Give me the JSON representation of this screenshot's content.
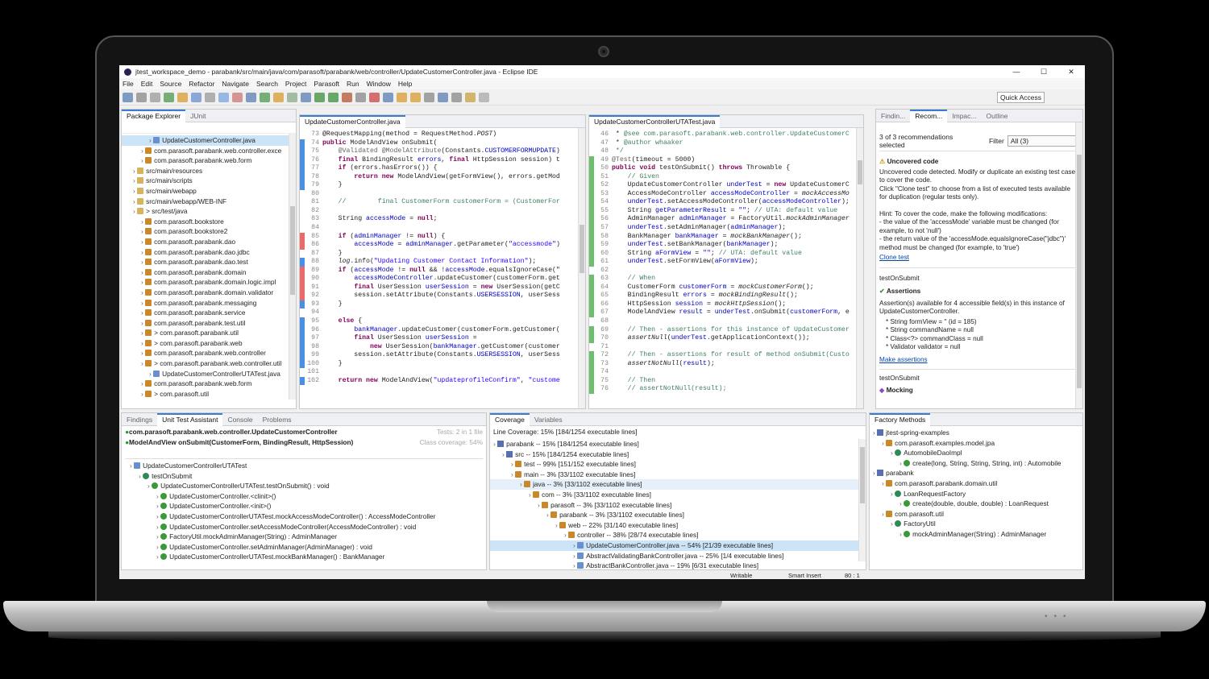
{
  "window_title": "jtest_workspace_demo - parabank/src/main/java/com/parasoft/parabank/web/controller/UpdateCustomerController.java - Eclipse IDE",
  "menu": [
    "File",
    "Edit",
    "Source",
    "Refactor",
    "Navigate",
    "Search",
    "Project",
    "Parasoft",
    "Run",
    "Window",
    "Help"
  ],
  "quick_access": "Quick Access",
  "package_explorer": {
    "tabs": [
      "Package Explorer",
      "JUnit"
    ],
    "rows": [
      {
        "indent": 3,
        "icon": "jfile",
        "label": "UpdateCustomerController.java",
        "sel": true
      },
      {
        "indent": 2,
        "icon": "pkg",
        "label": "com.parasoft.parabank.web.controller.exce"
      },
      {
        "indent": 2,
        "icon": "pkg",
        "label": "com.parasoft.parabank.web.form"
      },
      {
        "indent": 1,
        "icon": "fld",
        "label": "src/main/resources"
      },
      {
        "indent": 1,
        "icon": "fld",
        "label": "src/main/scripts"
      },
      {
        "indent": 1,
        "icon": "fld",
        "label": "src/main/webapp"
      },
      {
        "indent": 1,
        "icon": "fld",
        "label": "src/main/webapp/WEB-INF"
      },
      {
        "indent": 1,
        "icon": "fld",
        "label": "> src/test/java"
      },
      {
        "indent": 2,
        "icon": "pkg",
        "label": "com.parasoft.bookstore"
      },
      {
        "indent": 2,
        "icon": "pkg",
        "label": "com.parasoft.bookstore2"
      },
      {
        "indent": 2,
        "icon": "pkg",
        "label": "com.parasoft.parabank.dao"
      },
      {
        "indent": 2,
        "icon": "pkg",
        "label": "com.parasoft.parabank.dao.jdbc"
      },
      {
        "indent": 2,
        "icon": "pkg",
        "label": "com.parasoft.parabank.dao.test"
      },
      {
        "indent": 2,
        "icon": "pkg",
        "label": "com.parasoft.parabank.domain"
      },
      {
        "indent": 2,
        "icon": "pkg",
        "label": "com.parasoft.parabank.domain.logic.impl"
      },
      {
        "indent": 2,
        "icon": "pkg",
        "label": "com.parasoft.parabank.domain.validator"
      },
      {
        "indent": 2,
        "icon": "pkg",
        "label": "com.parasoft.parabank.messaging"
      },
      {
        "indent": 2,
        "icon": "pkg",
        "label": "com.parasoft.parabank.service"
      },
      {
        "indent": 2,
        "icon": "pkg",
        "label": "com.parasoft.parabank.test.util"
      },
      {
        "indent": 2,
        "icon": "pkg",
        "label": "> com.parasoft.parabank.util"
      },
      {
        "indent": 2,
        "icon": "pkg",
        "label": "> com.parasoft.parabank.web"
      },
      {
        "indent": 2,
        "icon": "pkg",
        "label": "com.parasoft.parabank.web.controller"
      },
      {
        "indent": 2,
        "icon": "pkg",
        "label": "> com.parasoft.parabank.web.controller.util"
      },
      {
        "indent": 3,
        "icon": "jfile",
        "label": "UpdateCustomerControllerUTATest.java"
      },
      {
        "indent": 2,
        "icon": "pkg",
        "label": "com.parasoft.parabank.web.form"
      },
      {
        "indent": 2,
        "icon": "pkg",
        "label": "> com.parasoft.util"
      }
    ]
  },
  "editor1": {
    "tab": "UpdateCustomerController.java",
    "lines": [
      {
        "n": "73",
        "h": "@RequestMapping(method = RequestMethod.<i>POST</i>)"
      },
      {
        "n": "74",
        "h": "<k>public</k> ModelAndView onSubmit("
      },
      {
        "n": "75",
        "h": "    <a>@Validated</a> <a>@ModelAttribute</a>(Constants.<f>CUSTOMERFORMUPDATE</f>)"
      },
      {
        "n": "76",
        "h": "    <k>final</k> BindingResult <f>errors</f>, <k>final</k> HttpSession session) t"
      },
      {
        "n": "77",
        "h": "    <k>if</k> (errors.hasErrors()) {"
      },
      {
        "n": "78",
        "h": "        <k>return new</k> ModelAndView(getFormView(), errors.getMod"
      },
      {
        "n": "79",
        "h": "    }"
      },
      {
        "n": "80",
        "h": ""
      },
      {
        "n": "81",
        "h": "    <c>//        final CustomerForm customerForm = (CustomerFor</c>"
      },
      {
        "n": "82",
        "h": ""
      },
      {
        "n": "83",
        "h": "    String <f>accessMode</f> = <k>null</k>;"
      },
      {
        "n": "84",
        "h": ""
      },
      {
        "n": "85",
        "h": "    <k>if</k> (<f>adminManager</f> != <k>null</k>) {"
      },
      {
        "n": "86",
        "h": "        <f>accessMode</f> = <f>adminManager</f>.getParameter(<s>\"accessmode\"</s>)"
      },
      {
        "n": "87",
        "h": "    }"
      },
      {
        "n": "88",
        "h": "    <i>log</i>.info(<s>\"Updating Customer Contact Information\"</s>);"
      },
      {
        "n": "89",
        "h": "    <k>if</k> (<f>accessMode</f> != <k>null</k> && !<f>accessMode</f>.equalsIgnoreCase(\""
      },
      {
        "n": "90",
        "h": "        <f>accessModeController</f>.updateCustomer(customerForm.get"
      },
      {
        "n": "91",
        "h": "        <k>final</k> UserSession <f>userSession</f> = <k>new</k> UserSession(getC"
      },
      {
        "n": "92",
        "h": "        session.setAttribute(Constants.<f>USERSESSION</f>, userSess"
      },
      {
        "n": "93",
        "h": "    }"
      },
      {
        "n": "94",
        "h": ""
      },
      {
        "n": "95",
        "h": "    <k>else</k> {"
      },
      {
        "n": "96",
        "h": "        <f>bankManager</f>.updateCustomer(customerForm.getCustomer("
      },
      {
        "n": "97",
        "h": "        <k>final</k> UserSession <f>userSession</f> ="
      },
      {
        "n": "98",
        "h": "            <k>new</k> UserSession(<f>bankManager</f>.getCustomer(customer"
      },
      {
        "n": "99",
        "h": "        session.setAttribute(Constants.<f>USERSESSION</f>, userSess"
      },
      {
        "n": "100",
        "h": "    }"
      },
      {
        "n": "101",
        "h": ""
      },
      {
        "n": "102",
        "h": "    <k>return new</k> ModelAndView(<s>\"updateprofileConfirm\"</s>, <s>\"custome</s>"
      }
    ]
  },
  "editor2": {
    "tab": "UpdateCustomerControllerUTATest.java",
    "lines": [
      {
        "n": "46",
        "h": " * <c>@see com.parasoft.parabank.web.controller.UpdateCustomerC</c>"
      },
      {
        "n": "47",
        "h": " * <c>@author whaaker</c>"
      },
      {
        "n": "48",
        "h": " <c>*/</c>"
      },
      {
        "n": "49",
        "h": "<a>@Test</a>(timeout = 5000)"
      },
      {
        "n": "50",
        "h": "<k>public void</k> testOnSubmit() <k>throws</k> Throwable {"
      },
      {
        "n": "51",
        "h": "    <c>// Given</c>"
      },
      {
        "n": "52",
        "h": "    UpdateCustomerController <f>underTest</f> = <k>new</k> UpdateCustomerC"
      },
      {
        "n": "53",
        "h": "    AccessModeController <f>accessModeController</f> = <i>mockAccessMo</i>"
      },
      {
        "n": "54",
        "h": "    <f>underTest</f>.setAccessModeController(<f>accessModeController</f>);"
      },
      {
        "n": "55",
        "h": "    String <f>getParameterResult</f> = <s>\"\"</s>; <c>// UTA: default value</c>"
      },
      {
        "n": "56",
        "h": "    AdminManager <f>adminManager</f> = FactoryUtil.<i>mockAdminManager</i>"
      },
      {
        "n": "57",
        "h": "    <f>underTest</f>.setAdminManager(<f>adminManager</f>);"
      },
      {
        "n": "58",
        "h": "    BankManager <f>bankManager</f> = <i>mockBankManager</i>();"
      },
      {
        "n": "59",
        "h": "    <f>underTest</f>.setBankManager(<f>bankManager</f>);"
      },
      {
        "n": "60",
        "h": "    String <f>aFormView</f> = <s>\"\"</s>; <c>// UTA: default value</c>"
      },
      {
        "n": "61",
        "h": "    <f>underTest</f>.setFormView(<f>aFormView</f>);"
      },
      {
        "n": "62",
        "h": ""
      },
      {
        "n": "63",
        "h": "    <c>// When</c>"
      },
      {
        "n": "64",
        "h": "    CustomerForm <f>customerForm</f> = <i>mockCustomerForm</i>();"
      },
      {
        "n": "65",
        "h": "    BindingResult <f>errors</f> = <i>mockBindingResult</i>();"
      },
      {
        "n": "66",
        "h": "    HttpSession <f>session</f> = <i>mockHttpSession</i>();"
      },
      {
        "n": "67",
        "h": "    ModelAndView <f>result</f> = <f>underTest</f>.onSubmit(<f>customerForm</f>, e"
      },
      {
        "n": "68",
        "h": ""
      },
      {
        "n": "69",
        "h": "    <c>// Then - assertions for this instance of UpdateCustomer</c>"
      },
      {
        "n": "70",
        "h": "    <i>assertNull</i>(<f>underTest</f>.getApplicationContext());"
      },
      {
        "n": "71",
        "h": ""
      },
      {
        "n": "72",
        "h": "    <c>// Then - assertions for result of method onSubmit(Custo</c>"
      },
      {
        "n": "73",
        "h": "    <i>assertNotNull</i>(<f>result</f>);"
      },
      {
        "n": "74",
        "h": ""
      },
      {
        "n": "75",
        "h": "    <c>// Then</c>"
      },
      {
        "n": "76",
        "h": "    <c>// assertNotNull(result);</c>"
      }
    ]
  },
  "recommendations": {
    "tabs": [
      "Findin...",
      "Recom...",
      "Impac...",
      "Outline"
    ],
    "summary": "3 of 3 recommendations selected",
    "filter_label": "Filter",
    "filter_value": "All (3)",
    "uncovered_title": "Uncovered code",
    "uncovered_p1": "Uncovered code detected. Modify or duplicate an existing test case to cover the code.",
    "uncovered_p2": "Click \"Clone test\" to choose from a list of executed tests available for duplication (regular tests only).",
    "hint_title": "Hint: To cover the code, make the following modifications:",
    "hint_1": "- the value of the 'accessMode' variable must be changed (for example, to not 'null')",
    "hint_2": "- the return value of the 'accessMode.equalsIgnoreCase(\"jdbc\")' method must be changed (for example, to 'true')",
    "clone_link": "Clone test",
    "section1": "testOnSubmit",
    "assert_title": "Assertions",
    "assert_p1": "Assertion(s) available for 4 accessible field(s) in this instance of UpdateCustomerController.",
    "assert_f1": "* String formView = '' (id = 185)",
    "assert_f2": "* String commandName = null",
    "assert_f3": "* Class<?> commandClass = null",
    "assert_f4": "* Validator validator = null",
    "assert_link": "Make assertions",
    "section2": "testOnSubmit",
    "mock_title": "Mocking"
  },
  "uta": {
    "tabs": [
      "Findings",
      "Unit Test Assistant",
      "Console",
      "Problems"
    ],
    "class_label": "com.parasoft.parabank.web.controller.UpdateCustomerController",
    "method_label": "ModelAndView onSubmit(CustomerForm, BindingResult, HttpSession)",
    "tests_info": "Tests: 2 in 1 file",
    "class_cov": "Class coverage: 54%",
    "rows": [
      {
        "indent": 0,
        "label": "UpdateCustomerControllerUTATest"
      },
      {
        "indent": 1,
        "label": "testOnSubmit"
      },
      {
        "indent": 2,
        "label": "UpdateCustomerControllerUTATest.testOnSubmit() : void"
      },
      {
        "indent": 3,
        "label": "UpdateCustomerController.<clinit>()"
      },
      {
        "indent": 3,
        "label": "UpdateCustomerController.<init>()"
      },
      {
        "indent": 3,
        "label": "UpdateCustomerControllerUTATest.mockAccessModeController() : AccessModeController"
      },
      {
        "indent": 3,
        "label": "UpdateCustomerController.setAccessModeController(AccessModeController) : void"
      },
      {
        "indent": 3,
        "label": "FactoryUtil.mockAdminManager(String) : AdminManager"
      },
      {
        "indent": 3,
        "label": "UpdateCustomerController.setAdminManager(AdminManager) : void"
      },
      {
        "indent": 3,
        "label": "UpdateCustomerControllerUTATest.mockBankManager() : BankManager"
      }
    ]
  },
  "coverage": {
    "tabs": [
      "Coverage",
      "Variables"
    ],
    "line_cov": "Line Coverage: 15% [184/1254 executable lines]",
    "rows": [
      {
        "indent": 0,
        "label": "parabank -- 15% [184/1254 executable lines]"
      },
      {
        "indent": 1,
        "label": "src -- 15% [184/1254 executable lines]"
      },
      {
        "indent": 2,
        "label": "test -- 99% [151/152 executable lines]"
      },
      {
        "indent": 2,
        "label": "main -- 3% [33/1102 executable lines]"
      },
      {
        "indent": 3,
        "label": "java -- 3% [33/1102 executable lines]",
        "hl": true
      },
      {
        "indent": 4,
        "label": "com -- 3% [33/1102 executable lines]"
      },
      {
        "indent": 5,
        "label": "parasoft -- 3% [33/1102 executable lines]"
      },
      {
        "indent": 6,
        "label": "parabank -- 3% [33/1102 executable lines]"
      },
      {
        "indent": 7,
        "label": "web -- 22% [31/140 executable lines]"
      },
      {
        "indent": 8,
        "label": "controller -- 38% [28/74 executable lines]"
      },
      {
        "indent": 9,
        "label": "UpdateCustomerController.java -- 54% [21/39 executable lines]",
        "sel": true
      },
      {
        "indent": 9,
        "label": "AbstractValidatingBankController.java -- 25% [1/4 executable lines]"
      },
      {
        "indent": 9,
        "label": "AbstractBankController.java -- 19% [6/31 executable lines]"
      }
    ]
  },
  "factory": {
    "tabs": [
      "Factory Methods"
    ],
    "rows": [
      {
        "indent": 0,
        "label": "jtest-spring-examples",
        "icon": "proj"
      },
      {
        "indent": 1,
        "label": "com.parasoft.examples.model.jpa",
        "icon": "pkg"
      },
      {
        "indent": 2,
        "label": "AutomobileDaoImpl",
        "icon": "cls"
      },
      {
        "indent": 3,
        "label": "create(long, String, String, String, int) : Automobile",
        "icon": "m"
      },
      {
        "indent": 0,
        "label": "parabank",
        "icon": "proj"
      },
      {
        "indent": 1,
        "label": "com.parasoft.parabank.domain.util",
        "icon": "pkg"
      },
      {
        "indent": 2,
        "label": "LoanRequestFactory",
        "icon": "cls"
      },
      {
        "indent": 3,
        "label": "create(double, double, double) : LoanRequest",
        "icon": "m"
      },
      {
        "indent": 1,
        "label": "com.parasoft.util",
        "icon": "pkg"
      },
      {
        "indent": 2,
        "label": "FactoryUtil",
        "icon": "cls"
      },
      {
        "indent": 3,
        "label": "mockAdminManager(String) : AdminManager",
        "icon": "m"
      }
    ]
  },
  "status": {
    "writable": "Writable",
    "insert": "Smart Insert",
    "pos": "80 : 1"
  }
}
